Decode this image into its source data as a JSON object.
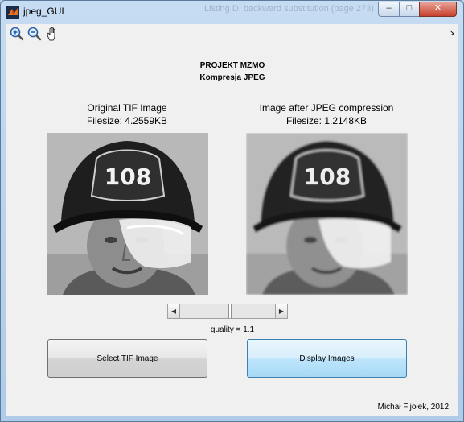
{
  "window": {
    "title": "jpeg_GUI",
    "ghost_title": "Listing D. backward substitution (page 273)",
    "controls": {
      "minimize": "–",
      "maximize": "□",
      "close": "✕"
    }
  },
  "toolbar": {
    "icons": [
      "zoom-in-icon",
      "zoom-out-icon",
      "pan-hand-icon"
    ],
    "dock_glyph": "↘"
  },
  "header": {
    "line1": "PROJEKT MZMO",
    "line2": "Kompresja JPEG"
  },
  "original": {
    "title": "Original TIF Image",
    "filesize": "Filesize: 4.2559KB"
  },
  "compressed": {
    "title": "Image after JPEG compression",
    "filesize": "Filesize: 1.2148KB"
  },
  "slider": {
    "left_arrow": "◀",
    "right_arrow": "▶",
    "position": 0.53
  },
  "quality_label": "quality = 1.1",
  "buttons": {
    "select": "Select TIF Image",
    "display": "Display Images"
  },
  "footer": "Michał Fijołek, 2012",
  "helmet_number": "108",
  "colors": {
    "titlebar": "#b9d1ea",
    "panel": "#f0f0f0",
    "display_button": "#bee6fd",
    "close_button": "#c7402c"
  }
}
